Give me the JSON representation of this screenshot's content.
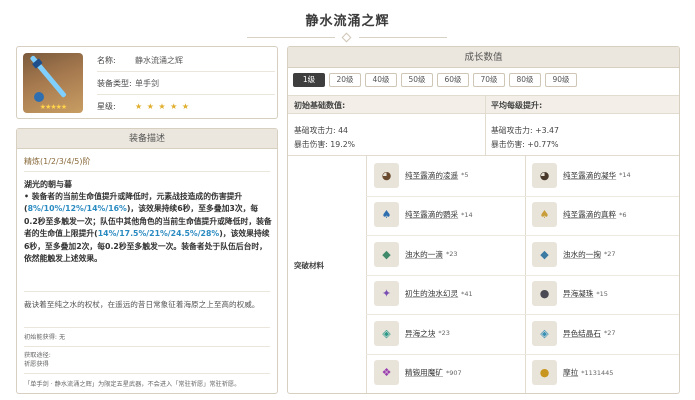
{
  "page": {
    "title": "静水流涌之辉"
  },
  "weapon": {
    "name_key": "名称:",
    "name": "静水流涌之辉",
    "type_key": "装备类型:",
    "type": "单手剑",
    "rarity_key": "星级:",
    "rarity_stars": "★ ★ ★ ★ ★",
    "img_stars": "★★★★★",
    "rarity_value": 5
  },
  "description": {
    "header": "装备描述",
    "refine": "精炼(1/2/3/4/5)阶",
    "passive_name": "湖光的朝与暮",
    "passive_text_1": "• 装备者的当前生命值提升或降低时，元素战技造成的伤害提升(",
    "passive_hl_1": "8%/10%/12%/14%/16%",
    "passive_text_2": ")，该效果持续6秒，至多叠加3次，每0.2秒至多触发一次；队伍中其他角色的当前生命值提升或降低时，装备者的生命值上限提升(",
    "passive_hl_2": "14%/17.5%/21%/24.5%/28%",
    "passive_text_3": ")，该效果持续6秒，至多叠加2次，每0.2秒至多触发一次。装备者处于队伍后台时，依然能触发上述效果。",
    "lore": "裁诀着至纯之水的权杖，在遥远的昔日常象征着海原之上至高的权威。",
    "source_line": "初始能获得: 无",
    "obtain_label": "获取途径:",
    "obtain_value": "祈愿获得",
    "footnote": "「单手剑 · 静水流涌之辉」为限定五星武器，不会进入「常驻祈愿」常驻祈愿。"
  },
  "growth": {
    "header": "成长数值",
    "levels": [
      "1级",
      "20级",
      "40级",
      "50级",
      "60级",
      "70级",
      "80级",
      "90级"
    ],
    "active_level": "1级",
    "base_header": "初始基础数值:",
    "per_header": "平均每级提升:",
    "base_atk": "基础攻击力: 44",
    "base_crit": "暴击伤害: 19.2%",
    "per_atk": "基础攻击力: +3.47",
    "per_crit": "暴击伤害: +0.77%",
    "materials_label": "突破材料",
    "materials": [
      {
        "name": "纯圣露滴的凌遥",
        "count": "*5",
        "icon": "shell-icon",
        "color": "#6a4b2e",
        "glyph": "◕"
      },
      {
        "name": "纯圣露滴的凝华",
        "count": "*14",
        "icon": "shell-icon",
        "color": "#4a3a2c",
        "glyph": "◕"
      },
      {
        "name": "纯圣露滴的鹦采",
        "count": "*14",
        "icon": "bird-icon",
        "color": "#2f6fb0",
        "glyph": "♠"
      },
      {
        "name": "纯圣露滴的真粹",
        "count": "*6",
        "icon": "bird-icon",
        "color": "#c89e3a",
        "glyph": "♠"
      },
      {
        "name": "浊水的一滴",
        "count": "*23",
        "icon": "drop-icon",
        "color": "#3f8a6a",
        "glyph": "◆"
      },
      {
        "name": "浊水的一掬",
        "count": "*27",
        "icon": "drop-icon",
        "color": "#3a7aa3",
        "glyph": "◆"
      },
      {
        "name": "初生的浊水幻灵",
        "count": "*41",
        "icon": "spirit-icon",
        "color": "#7a4fb3",
        "glyph": "✦"
      },
      {
        "name": "异海凝珠",
        "count": "*15",
        "icon": "pearl-icon",
        "color": "#4b4b55",
        "glyph": "●"
      },
      {
        "name": "异海之块",
        "count": "*23",
        "icon": "crystal-icon",
        "color": "#2e9a8a",
        "glyph": "◈"
      },
      {
        "name": "异色结晶石",
        "count": "*27",
        "icon": "crystal-icon",
        "color": "#3a8fb5",
        "glyph": "◈"
      },
      {
        "name": "精锻用魔矿",
        "count": "*907",
        "icon": "ore-icon",
        "color": "#9b3fb0",
        "glyph": "❖"
      },
      {
        "name": "摩拉",
        "count": "*1131445",
        "icon": "mora-icon",
        "color": "#c8961e",
        "glyph": "●"
      }
    ]
  }
}
